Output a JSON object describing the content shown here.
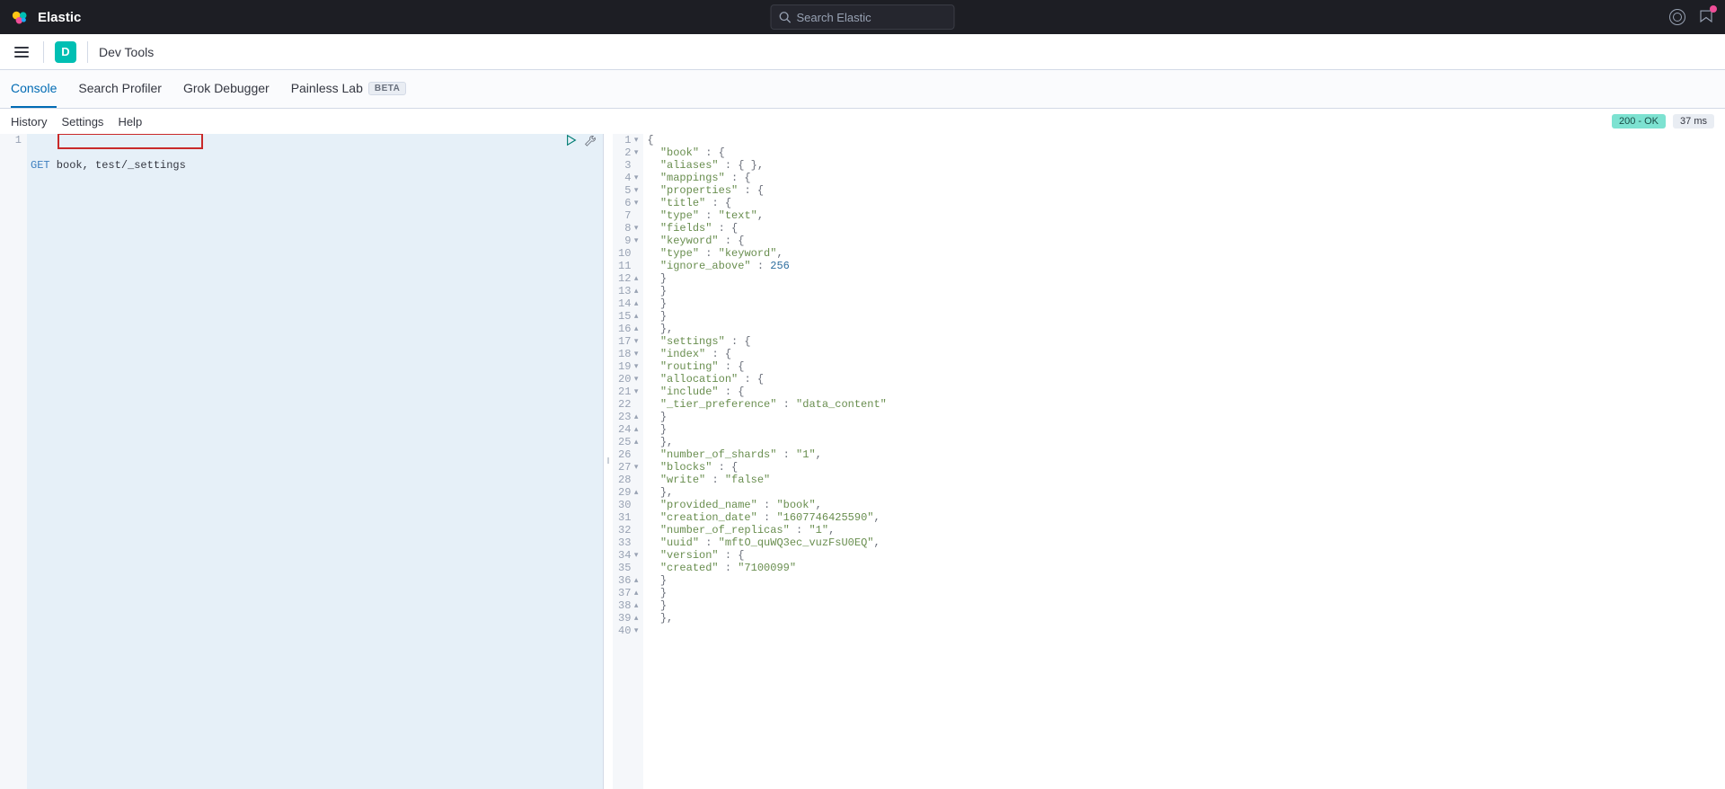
{
  "brand": "Elastic",
  "search_placeholder": "Search Elastic",
  "space_initial": "D",
  "breadcrumb": "Dev Tools",
  "tabs": {
    "console": "Console",
    "profiler": "Search Profiler",
    "grok": "Grok Debugger",
    "painless": "Painless Lab",
    "beta": "BETA"
  },
  "toolbar": {
    "history": "History",
    "settings": "Settings",
    "help": "Help",
    "status": "200 - OK",
    "time": "37 ms"
  },
  "request": {
    "line_no": "1",
    "method": "GET",
    "path": " book, test/_settings"
  },
  "response_lines": [
    {
      "no": "1",
      "fold": "▾",
      "t": [
        [
          "p",
          "{"
        ]
      ]
    },
    {
      "no": "2",
      "fold": "▾",
      "t": [
        [
          "p",
          "  "
        ],
        [
          "k",
          "\"book\""
        ],
        [
          "p",
          " : {"
        ]
      ]
    },
    {
      "no": "3",
      "fold": "",
      "t": [
        [
          "p",
          "    "
        ],
        [
          "k",
          "\"aliases\""
        ],
        [
          "p",
          " : { },"
        ]
      ]
    },
    {
      "no": "4",
      "fold": "▾",
      "t": [
        [
          "p",
          "    "
        ],
        [
          "k",
          "\"mappings\""
        ],
        [
          "p",
          " : {"
        ]
      ]
    },
    {
      "no": "5",
      "fold": "▾",
      "t": [
        [
          "p",
          "      "
        ],
        [
          "k",
          "\"properties\""
        ],
        [
          "p",
          " : {"
        ]
      ]
    },
    {
      "no": "6",
      "fold": "▾",
      "t": [
        [
          "p",
          "        "
        ],
        [
          "k",
          "\"title\""
        ],
        [
          "p",
          " : {"
        ]
      ]
    },
    {
      "no": "7",
      "fold": "",
      "t": [
        [
          "p",
          "          "
        ],
        [
          "k",
          "\"type\""
        ],
        [
          "p",
          " : "
        ],
        [
          "s",
          "\"text\""
        ],
        [
          "p",
          ","
        ]
      ]
    },
    {
      "no": "8",
      "fold": "▾",
      "t": [
        [
          "p",
          "          "
        ],
        [
          "k",
          "\"fields\""
        ],
        [
          "p",
          " : {"
        ]
      ]
    },
    {
      "no": "9",
      "fold": "▾",
      "t": [
        [
          "p",
          "            "
        ],
        [
          "k",
          "\"keyword\""
        ],
        [
          "p",
          " : {"
        ]
      ]
    },
    {
      "no": "10",
      "fold": "",
      "t": [
        [
          "p",
          "              "
        ],
        [
          "k",
          "\"type\""
        ],
        [
          "p",
          " : "
        ],
        [
          "s",
          "\"keyword\""
        ],
        [
          "p",
          ","
        ]
      ]
    },
    {
      "no": "11",
      "fold": "",
      "t": [
        [
          "p",
          "              "
        ],
        [
          "k",
          "\"ignore_above\""
        ],
        [
          "p",
          " : "
        ],
        [
          "n",
          "256"
        ]
      ]
    },
    {
      "no": "12",
      "fold": "▴",
      "t": [
        [
          "p",
          "            }"
        ]
      ]
    },
    {
      "no": "13",
      "fold": "▴",
      "t": [
        [
          "p",
          "          }"
        ]
      ]
    },
    {
      "no": "14",
      "fold": "▴",
      "t": [
        [
          "p",
          "        }"
        ]
      ]
    },
    {
      "no": "15",
      "fold": "▴",
      "t": [
        [
          "p",
          "      }"
        ]
      ]
    },
    {
      "no": "16",
      "fold": "▴",
      "t": [
        [
          "p",
          "    },"
        ]
      ]
    },
    {
      "no": "17",
      "fold": "▾",
      "t": [
        [
          "p",
          "    "
        ],
        [
          "k",
          "\"settings\""
        ],
        [
          "p",
          " : {"
        ]
      ]
    },
    {
      "no": "18",
      "fold": "▾",
      "t": [
        [
          "p",
          "      "
        ],
        [
          "k",
          "\"index\""
        ],
        [
          "p",
          " : {"
        ]
      ]
    },
    {
      "no": "19",
      "fold": "▾",
      "t": [
        [
          "p",
          "        "
        ],
        [
          "k",
          "\"routing\""
        ],
        [
          "p",
          " : {"
        ]
      ]
    },
    {
      "no": "20",
      "fold": "▾",
      "t": [
        [
          "p",
          "          "
        ],
        [
          "k",
          "\"allocation\""
        ],
        [
          "p",
          " : {"
        ]
      ]
    },
    {
      "no": "21",
      "fold": "▾",
      "t": [
        [
          "p",
          "            "
        ],
        [
          "k",
          "\"include\""
        ],
        [
          "p",
          " : {"
        ]
      ]
    },
    {
      "no": "22",
      "fold": "",
      "t": [
        [
          "p",
          "              "
        ],
        [
          "k",
          "\"_tier_preference\""
        ],
        [
          "p",
          " : "
        ],
        [
          "s",
          "\"data_content\""
        ]
      ]
    },
    {
      "no": "23",
      "fold": "▴",
      "t": [
        [
          "p",
          "            }"
        ]
      ]
    },
    {
      "no": "24",
      "fold": "▴",
      "t": [
        [
          "p",
          "          }"
        ]
      ]
    },
    {
      "no": "25",
      "fold": "▴",
      "t": [
        [
          "p",
          "        },"
        ]
      ]
    },
    {
      "no": "26",
      "fold": "",
      "t": [
        [
          "p",
          "        "
        ],
        [
          "k",
          "\"number_of_shards\""
        ],
        [
          "p",
          " : "
        ],
        [
          "s",
          "\"1\""
        ],
        [
          "p",
          ","
        ]
      ]
    },
    {
      "no": "27",
      "fold": "▾",
      "t": [
        [
          "p",
          "        "
        ],
        [
          "k",
          "\"blocks\""
        ],
        [
          "p",
          " : {"
        ]
      ]
    },
    {
      "no": "28",
      "fold": "",
      "t": [
        [
          "p",
          "          "
        ],
        [
          "k",
          "\"write\""
        ],
        [
          "p",
          " : "
        ],
        [
          "s",
          "\"false\""
        ]
      ]
    },
    {
      "no": "29",
      "fold": "▴",
      "t": [
        [
          "p",
          "        },"
        ]
      ]
    },
    {
      "no": "30",
      "fold": "",
      "t": [
        [
          "p",
          "        "
        ],
        [
          "k",
          "\"provided_name\""
        ],
        [
          "p",
          " : "
        ],
        [
          "s",
          "\"book\""
        ],
        [
          "p",
          ","
        ]
      ]
    },
    {
      "no": "31",
      "fold": "",
      "t": [
        [
          "p",
          "        "
        ],
        [
          "k",
          "\"creation_date\""
        ],
        [
          "p",
          " : "
        ],
        [
          "s",
          "\"1607746425590\""
        ],
        [
          "p",
          ","
        ]
      ]
    },
    {
      "no": "32",
      "fold": "",
      "t": [
        [
          "p",
          "        "
        ],
        [
          "k",
          "\"number_of_replicas\""
        ],
        [
          "p",
          " : "
        ],
        [
          "s",
          "\"1\""
        ],
        [
          "p",
          ","
        ]
      ]
    },
    {
      "no": "33",
      "fold": "",
      "t": [
        [
          "p",
          "        "
        ],
        [
          "k",
          "\"uuid\""
        ],
        [
          "p",
          " : "
        ],
        [
          "s",
          "\"mftO_quWQ3ec_vuzFsU0EQ\""
        ],
        [
          "p",
          ","
        ]
      ]
    },
    {
      "no": "34",
      "fold": "▾",
      "t": [
        [
          "p",
          "        "
        ],
        [
          "k",
          "\"version\""
        ],
        [
          "p",
          " : {"
        ]
      ]
    },
    {
      "no": "35",
      "fold": "",
      "t": [
        [
          "p",
          "          "
        ],
        [
          "k",
          "\"created\""
        ],
        [
          "p",
          " : "
        ],
        [
          "s",
          "\"7100099\""
        ]
      ]
    },
    {
      "no": "36",
      "fold": "▴",
      "t": [
        [
          "p",
          "        }"
        ]
      ]
    },
    {
      "no": "37",
      "fold": "▴",
      "t": [
        [
          "p",
          "      }"
        ]
      ]
    },
    {
      "no": "38",
      "fold": "▴",
      "t": [
        [
          "p",
          "    }"
        ]
      ]
    },
    {
      "no": "39",
      "fold": "▴",
      "t": [
        [
          "p",
          "  },"
        ]
      ]
    },
    {
      "no": "40",
      "fold": "▾",
      "t": [
        [
          "p",
          ""
        ]
      ]
    }
  ]
}
